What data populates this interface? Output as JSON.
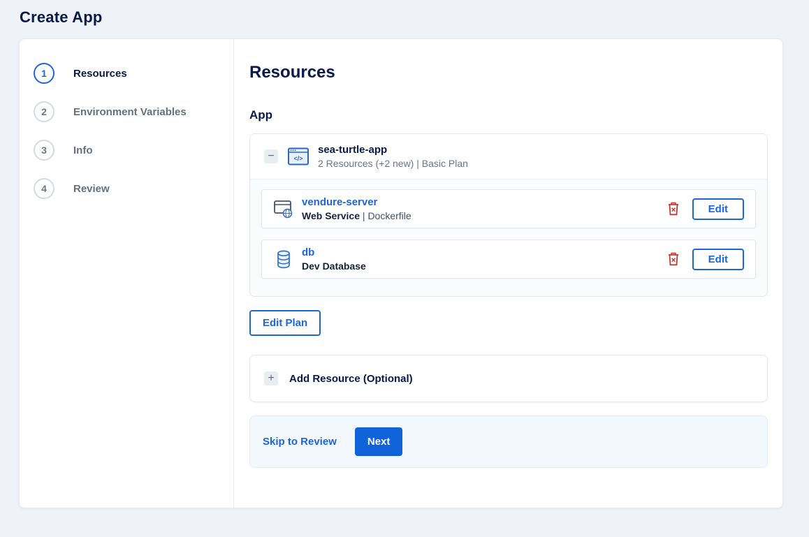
{
  "page": {
    "title": "Create App"
  },
  "stepper": {
    "steps": [
      {
        "num": "1",
        "label": "Resources"
      },
      {
        "num": "2",
        "label": "Environment Variables"
      },
      {
        "num": "3",
        "label": "Info"
      },
      {
        "num": "4",
        "label": "Review"
      }
    ]
  },
  "main": {
    "heading": "Resources",
    "section_label": "App",
    "app_group": {
      "name": "sea-turtle-app",
      "summary": "2 Resources (+2 new) | Basic Plan",
      "resources": [
        {
          "name": "vendure-server",
          "type": "Web Service",
          "separator": " | ",
          "detail": "Dockerfile",
          "icon": "web-service-icon",
          "edit_label": "Edit"
        },
        {
          "name": "db",
          "type": "Dev Database",
          "separator": "",
          "detail": "",
          "icon": "database-icon",
          "edit_label": "Edit"
        }
      ]
    },
    "edit_plan_label": "Edit Plan",
    "add_resource": {
      "label": "Add Resource (Optional)"
    },
    "footer": {
      "skip_label": "Skip to Review",
      "next_label": "Next"
    }
  },
  "icons": {
    "minus_glyph": "−",
    "plus_glyph": "+",
    "app_icon_code": "</>"
  },
  "colors": {
    "accent_blue": "#1b66dd",
    "primary_button_blue": "#0f62d8",
    "navy_text": "#08194a",
    "danger_red": "#c43b34",
    "page_background": "#eff2f6",
    "footer_background": "#f3f8fd"
  }
}
